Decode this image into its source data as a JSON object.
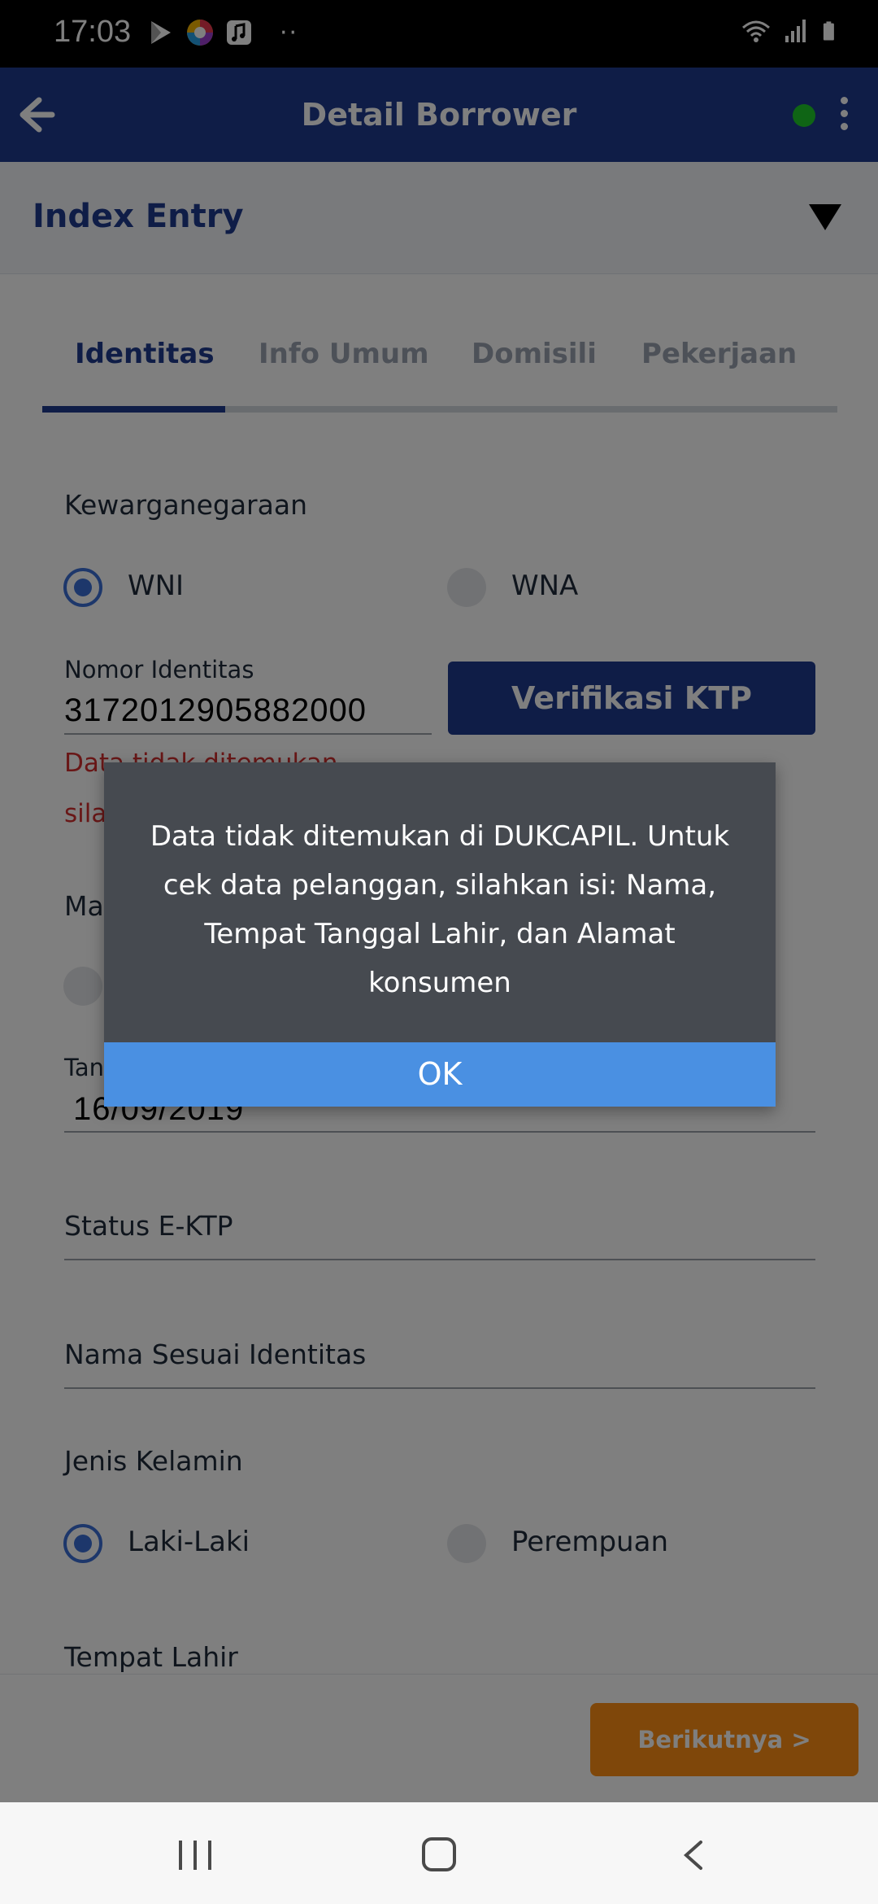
{
  "status_bar": {
    "time": "17:03",
    "left_icons": [
      "play-store-icon",
      "colorful-app-icon",
      "music-app-icon"
    ],
    "overflow": "··",
    "right_icons": [
      "wifi-icon",
      "signal-icon",
      "battery-icon"
    ]
  },
  "app_bar": {
    "title": "Detail Borrower",
    "online_status_color": "#1fcb2a"
  },
  "index_entry": {
    "title": "Index Entry"
  },
  "tabs": [
    {
      "label": "Identitas",
      "active": true
    },
    {
      "label": "Info Umum",
      "active": false
    },
    {
      "label": "Domisili",
      "active": false
    },
    {
      "label": "Pekerjaan",
      "active": false
    }
  ],
  "form": {
    "citizenship_label": "Kewarganegaraan",
    "citizenship_options": [
      {
        "label": "WNI",
        "selected": true
      },
      {
        "label": "WNA",
        "selected": false
      }
    ],
    "id_number_label": "Nomor Identitas",
    "id_number_value": "3172012905882000",
    "verify_button": "Verifikasi KTP",
    "error_line1": "Data tidak ditemukan",
    "error_line2": "sila",
    "ma_label_fragment": "Ma",
    "date_label_fragment": "Tan",
    "date_value": "16/09/2019",
    "ektp_status_label": "Status E-KTP",
    "name_label": "Nama Sesuai Identitas",
    "gender_label": "Jenis Kelamin",
    "gender_options": [
      {
        "label": "Laki-Laki",
        "selected": true
      },
      {
        "label": "Perempuan",
        "selected": false
      }
    ],
    "birthplace_label": "Tempat Lahir"
  },
  "footer": {
    "next_button": "Berikutnya >"
  },
  "dialog": {
    "message": "Data tidak ditemukan di DUKCAPIL. Untuk cek data pelanggan, silahkan isi: Nama, Tempat Tanggal Lahir, dan Alamat konsumen",
    "ok_label": "OK"
  },
  "colors": {
    "primary": "#1f3a8f",
    "accent_orange": "#ff8f14",
    "dialog_bg": "#464a50",
    "dialog_button": "#4a90e2",
    "error": "#d32f2f"
  }
}
